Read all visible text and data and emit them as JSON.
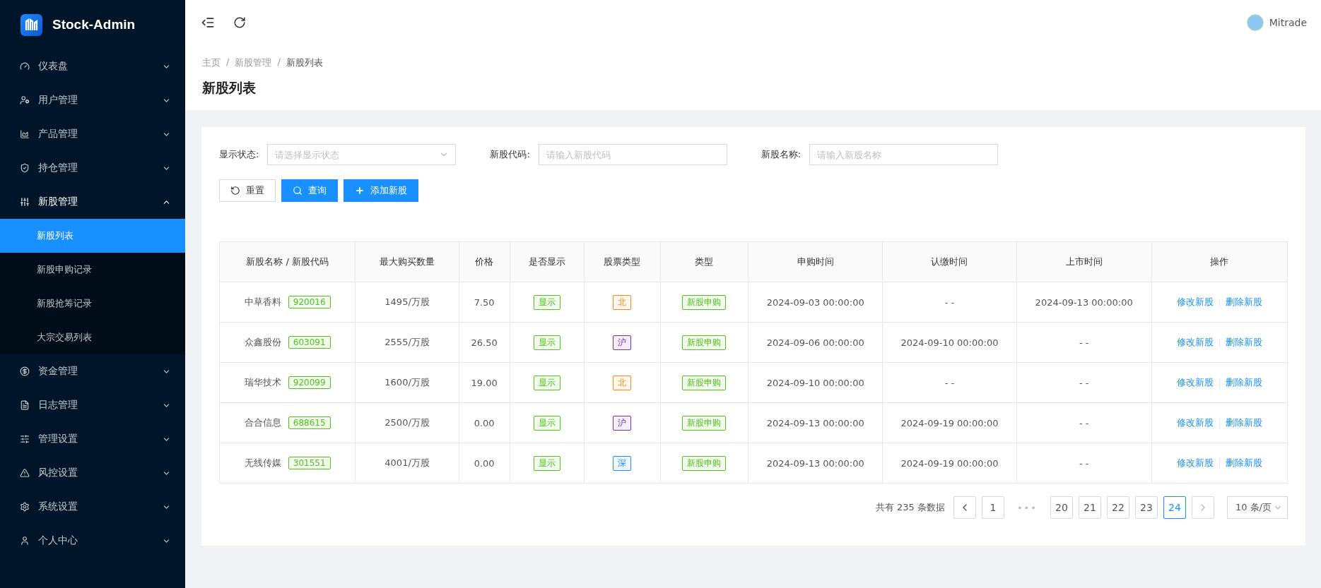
{
  "sidebar": {
    "logo_text": "Stock-Admin",
    "items": [
      {
        "label": "仪表盘",
        "expanded": false
      },
      {
        "label": "用户管理",
        "expanded": false
      },
      {
        "label": "产品管理",
        "expanded": false
      },
      {
        "label": "持仓管理",
        "expanded": false
      },
      {
        "label": "新股管理",
        "expanded": true,
        "children": [
          {
            "label": "新股列表",
            "selected": true
          },
          {
            "label": "新股申购记录",
            "selected": false
          },
          {
            "label": "新股抢筹记录",
            "selected": false
          },
          {
            "label": "大宗交易列表",
            "selected": false
          }
        ]
      },
      {
        "label": "资金管理",
        "expanded": false
      },
      {
        "label": "日志管理",
        "expanded": false
      },
      {
        "label": "管理设置",
        "expanded": false
      },
      {
        "label": "风控设置",
        "expanded": false
      },
      {
        "label": "系统设置",
        "expanded": false
      },
      {
        "label": "个人中心",
        "expanded": false
      }
    ]
  },
  "header": {
    "user_name": "Mitrade"
  },
  "breadcrumb": {
    "separator": "/",
    "items": [
      "主页",
      "新股管理",
      "新股列表"
    ]
  },
  "page_title": "新股列表",
  "filters": [
    {
      "kind": "select",
      "label": "显示状态:",
      "placeholder": "请选择显示状态"
    },
    {
      "kind": "input",
      "label": "新股代码:",
      "placeholder": "请输入新股代码"
    },
    {
      "kind": "input",
      "label": "新股名称:",
      "placeholder": "请输入新股名称"
    }
  ],
  "buttons": [
    {
      "kind": "reset",
      "label": "重置"
    },
    {
      "kind": "search",
      "label": "查询"
    },
    {
      "kind": "add",
      "label": "添加新股"
    }
  ],
  "table": {
    "columns": [
      "新股名称 / 新股代码",
      "最大购买数量",
      "价格",
      "是否显示",
      "股票类型",
      "类型",
      "申购时间",
      "认缴时间",
      "上市时间",
      "操作"
    ],
    "rows": [
      {
        "name": "中草香料",
        "code": "920016",
        "max_qty": "1495/万股",
        "price": "7.50",
        "display": "显示",
        "stock_type": "北",
        "color": "#fa8c16",
        "type": "新股申购",
        "subscribe_time": "2024-09-03 00:00:00",
        "pay_time": "- -",
        "listing_time": "2024-09-13 00:00:00",
        "actions": [
          "修改新股",
          "删除新股"
        ]
      },
      {
        "name": "众鑫股份",
        "code": "603091",
        "max_qty": "2555/万股",
        "price": "26.50",
        "display": "显示",
        "stock_type": "沪",
        "color": "#722ed1",
        "type": "新股申购",
        "subscribe_time": "2024-09-06 00:00:00",
        "pay_time": "2024-09-10 00:00:00",
        "listing_time": "- -",
        "actions": [
          "修改新股",
          "删除新股"
        ]
      },
      {
        "name": "瑞华技术",
        "code": "920099",
        "max_qty": "1600/万股",
        "price": "19.00",
        "display": "显示",
        "stock_type": "北",
        "color": "#fa8c16",
        "type": "新股申购",
        "subscribe_time": "2024-09-10 00:00:00",
        "pay_time": "- -",
        "listing_time": "- -",
        "actions": [
          "修改新股",
          "删除新股"
        ]
      },
      {
        "name": "合合信息",
        "code": "688615",
        "max_qty": "2500/万股",
        "price": "0.00",
        "display": "显示",
        "stock_type": "沪",
        "color": "#722ed1",
        "type": "新股申购",
        "subscribe_time": "2024-09-13 00:00:00",
        "pay_time": "2024-09-19 00:00:00",
        "listing_time": "- -",
        "actions": [
          "修改新股",
          "删除新股"
        ]
      },
      {
        "name": "无线传媒",
        "code": "301551",
        "max_qty": "4001/万股",
        "price": "0.00",
        "display": "显示",
        "stock_type": "深",
        "color": "#1890ff",
        "type": "新股申购",
        "subscribe_time": "2024-09-13 00:00:00",
        "pay_time": "2024-09-19 00:00:00",
        "listing_time": "- -",
        "actions": [
          "修改新股",
          "删除新股"
        ]
      }
    ]
  },
  "pagination": {
    "total": "共有 235 条数据",
    "first_page": {
      "label": "1",
      "selected": false
    },
    "ellipsis": "•••",
    "pages": [
      {
        "label": "20",
        "selected": false
      },
      {
        "label": "21",
        "selected": false
      },
      {
        "label": "22",
        "selected": false
      },
      {
        "label": "23",
        "selected": false
      },
      {
        "label": "24",
        "selected": true
      }
    ],
    "next_disabled": true,
    "page_size": "10 条/页"
  }
}
